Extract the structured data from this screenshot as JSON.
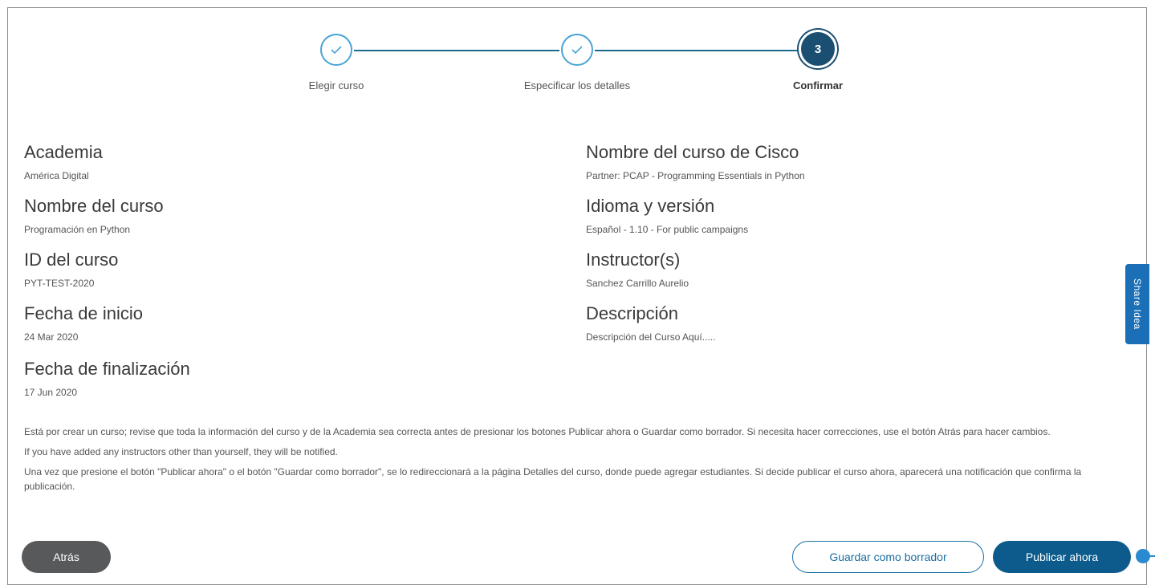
{
  "stepper": {
    "steps": [
      {
        "label": "Elegir curso",
        "state": "done",
        "icon": "check-icon"
      },
      {
        "label": "Especificar los detalles",
        "state": "done",
        "icon": "check-icon"
      },
      {
        "label": "Confirmar",
        "state": "active",
        "number": "3"
      }
    ]
  },
  "details": {
    "left": [
      {
        "label": "Academia",
        "value": "América Digital"
      },
      {
        "label": "Nombre del curso",
        "value": "Programación en Python"
      },
      {
        "label": "ID del curso",
        "value": "PYT-TEST-2020"
      },
      {
        "label": "Fecha de inicio",
        "value": "24 Mar 2020"
      },
      {
        "label": "Fecha de finalización",
        "value": "17 Jun 2020"
      }
    ],
    "right": [
      {
        "label": "Nombre del curso de Cisco",
        "value": "Partner: PCAP - Programming Essentials in Python"
      },
      {
        "label": "Idioma y versión",
        "value": "Español - 1.10 - For public campaigns"
      },
      {
        "label": "Instructor(s)",
        "value": "Sanchez Carrillo Aurelio"
      },
      {
        "label": "Descripción",
        "value": "Descripción del Curso Aquí....."
      }
    ]
  },
  "notes": [
    "Está por crear un curso; revise que toda la información del curso y de la Academia sea correcta antes de presionar los botones Publicar ahora o Guardar como borrador. Si necesita hacer correcciones, use el botón Atrás para hacer cambios.",
    "If you have added any instructors other than yourself, they will be notified.",
    "Una vez que presione el botón \"Publicar ahora\" o el botón \"Guardar como borrador\", se lo redireccionará a la página Detalles del curso, donde puede agregar estudiantes. Si decide publicar el curso ahora, aparecerá una notificación que confirma la publicación."
  ],
  "buttons": {
    "back": "Atrás",
    "draft": "Guardar como borrador",
    "publish": "Publicar ahora"
  },
  "share_idea": "Share Idea",
  "colors": {
    "accent": "#0c5b8c",
    "step_done_border": "#4aa3d6",
    "step_active": "#1b4f72",
    "share_tab": "#1a6fb6"
  }
}
